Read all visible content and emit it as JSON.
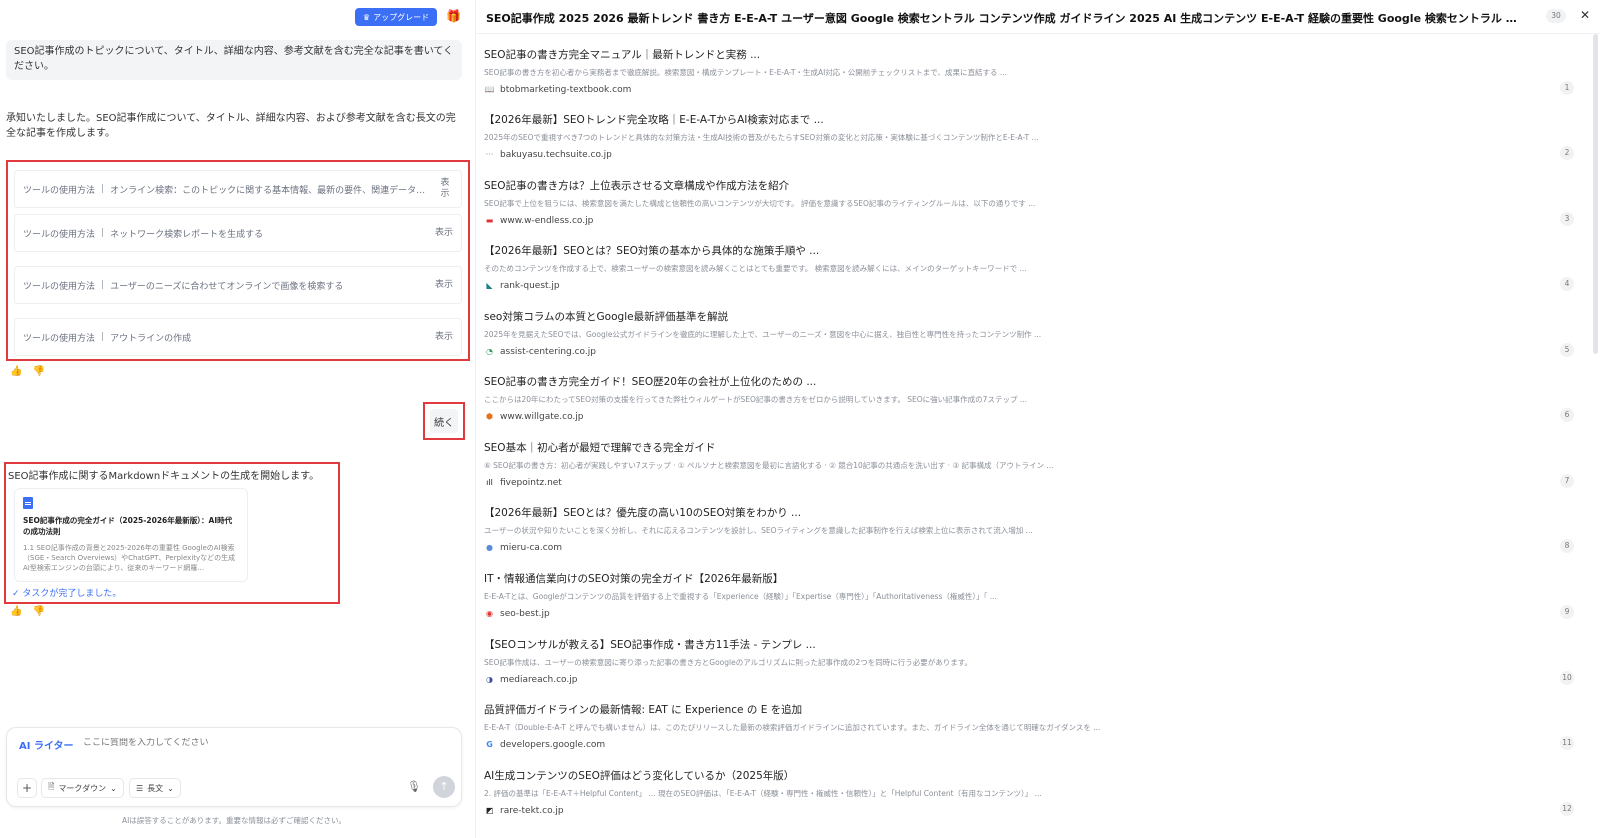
{
  "header": {
    "upgrade_label": "アップグレード"
  },
  "chat": {
    "user_message": "SEO記事作成のトピックについて、タイトル、詳細な内容、参考文献を含む完全な記事を書いてください。",
    "assistant_intro": "承知いたしました。SEO記事作成について、タイトル、詳細な内容、および参考文献を含む長文の完全な記事を作成します。",
    "tools": [
      {
        "label": "ツールの使用方法",
        "desc": "オンライン検索：このトピックに関する基本情報、最新の要件、関連データを...",
        "show": "表示"
      },
      {
        "label": "ツールの使用方法",
        "desc": "ネットワーク検索レポートを生成する",
        "show": "表示"
      },
      {
        "label": "ツールの使用方法",
        "desc": "ユーザーのニーズに合わせてオンラインで画像を検索する",
        "show": "表示"
      },
      {
        "label": "ツールの使用方法",
        "desc": "アウトラインの作成",
        "show": "表示"
      }
    ],
    "continue_label": "続く",
    "doc_intro": "SEO記事作成に関するMarkdownドキュメントの生成を開始します。",
    "doc_card": {
      "title": "SEO記事作成の完全ガイド（2025-2026年最新版）：AI時代の成功法則",
      "body": "1.1 SEO記事作成の背景と2025-2026年の重要性 GoogleのAI検索（SGE・Search Overviews）やChatGPT、Perplexityなどの生成AI型検索エンジンの台頭により、従来のキーワード網羅..."
    },
    "task_done": "タスクが完了しました。"
  },
  "composer": {
    "mode_label": "AI ライター",
    "placeholder": "ここに質問を入力してください",
    "format_label": "マークダウン",
    "length_label": "長文",
    "disclaimer": "AIは誤答することがあります。重要な情報は必ずご確認ください。"
  },
  "panel": {
    "title": "SEO記事作成 2025 2026 最新トレンド 書き方 E-E-A-T ユーザー意図 Google 検索セントラル コンテンツ作成 ガイドライン 2025 AI 生成コンテンツ E-E-A-T 経験の重要性 Google 検索セントラル コンテンツ作成 質の高い ...",
    "count": "30",
    "results": [
      {
        "title": "SEO記事の書き方完全マニュアル｜最新トレンドと実務 ...",
        "snippet": "SEO記事の書き方を初心者から実務者まで徹底解説。検索意図・構成テンプレート・E-E-A-T・生成AI対応・公開前チェックリストまで、成果に直結する ...",
        "domain": "btobmarketing-textbook.com",
        "num": "1",
        "fav": "📖",
        "favcolor": "#333"
      },
      {
        "title": "【2026年最新】SEOトレンド完全攻略｜E-E-A-TからAI検索対応まで ...",
        "snippet": "2025年のSEOで重視すべき7つのトレンドと具体的な対策方法・生成AI技術の普及がもたらすSEO対策の変化と対応策・実体験に基づくコンテンツ制作とE-E-A-T ...",
        "domain": "bakuyasu.techsuite.co.jp",
        "num": "2",
        "fav": "···",
        "favcolor": "#888"
      },
      {
        "title": "SEO記事の書き方は？上位表示させる文章構成や作成方法を紹介",
        "snippet": "SEO記事で上位を狙うには、検索意図を満たした構成と信頼性の高いコンテンツが大切です。 評価を意識するSEO記事のライティングルールは、以下の通りです ...",
        "domain": "www.w-endless.co.jp",
        "num": "3",
        "fav": "▬",
        "favcolor": "#d33"
      },
      {
        "title": "【2026年最新】SEOとは？SEO対策の基本から具体的な施策手順や ...",
        "snippet": "そのためコンテンツを作成する上で、検索ユーザーの検索意図を読み解くことはとても重要です。 検索意図を読み解くには、メインのターゲットキーワードで ...",
        "domain": "rank-quest.jp",
        "num": "4",
        "fav": "◣",
        "favcolor": "#1a7f86"
      },
      {
        "title": "seo対策コラムの本質とGoogle最新評価基準を解説",
        "snippet": "2025年を見据えたSEOでは、Google公式ガイドラインを徹底的に理解した上で、ユーザーのニーズ・意図を中心に据え、独自性と専門性を持ったコンテンツ制作 ...",
        "domain": "assist-centering.co.jp",
        "num": "5",
        "fav": "◔",
        "favcolor": "#2f9a5c"
      },
      {
        "title": "SEO記事の書き方完全ガイド！SEO歴20年の会社が上位化のための ...",
        "snippet": "ここからは20年にわたってSEO対策の支援を行ってきた弊社ウィルゲートがSEO記事の書き方をゼロから説明していきます。 SEOに強い記事作成の7ステップ ...",
        "domain": "www.willgate.co.jp",
        "num": "6",
        "fav": "⬢",
        "favcolor": "#e8701a"
      },
      {
        "title": "SEO基本｜初心者が最短で理解できる完全ガイド",
        "snippet": "⑥ SEO記事の書き方：初心者が実践しやすい7ステップ · ① ペルソナと検索意図を最初に言語化する · ② 競合10記事の共通点を洗い出す · ③ 記事構成（アウトライン ...",
        "domain": "fivepointz.net",
        "num": "7",
        "fav": "ıll",
        "favcolor": "#222"
      },
      {
        "title": "【2026年最新】SEOとは？優先度の高い10のSEO対策をわかり ...",
        "snippet": "ユーザーの状況や知りたいことを深く分析し、それに応えるコンテンツを設計し、SEOライティングを意識した記事制作を行えば検索上位に表示されて流入増加 ...",
        "domain": "mieru-ca.com",
        "num": "8",
        "fav": "●",
        "favcolor": "#5a8fd8"
      },
      {
        "title": "IT・情報通信業向けのSEO対策の完全ガイド【2026年最新版】",
        "snippet": "E-E-A-Tとは、Googleがコンテンツの品質を評価する上で重視する「Experience（経験）」「Expertise（専門性）」「Authoritativeness（権威性）」「 ...",
        "domain": "seo-best.jp",
        "num": "9",
        "fav": "◉",
        "favcolor": "#d33"
      },
      {
        "title": "【SEOコンサルが教える】SEO記事作成・書き方11手法 - テンプレ ...",
        "snippet": "SEO記事作成は、ユーザーの検索意図に寄り添った記事の書き方とGoogleのアルゴリズムに則った記事作成の2つを同時に行う必要があります。",
        "domain": "mediareach.co.jp",
        "num": "10",
        "fav": "◑",
        "favcolor": "#3b4fa0"
      },
      {
        "title": "品質評価ガイドラインの最新情報: EAT に Experience の E を追加",
        "snippet": "E-E-A-T（Double-E-A-T と呼んでも構いません）は、このたびリリースした最新の検索評価ガイドラインに追加されています。また、ガイドライン全体を通じて明確なガイダンスを ...",
        "domain": "developers.google.com",
        "num": "11",
        "fav": "G",
        "favcolor": "#4285f4"
      },
      {
        "title": "AI生成コンテンツのSEO評価はどう変化しているか（2025年版）",
        "snippet": "2. 評価の基準は「E-E-A-T＋Helpful Content」 ... 現在のSEO評価は、「E-E-A-T（経験・専門性・権威性・信頼性）」と「Helpful Content（有用なコンテンツ）」 ...",
        "domain": "rare-tekt.co.jp",
        "num": "12",
        "fav": "◩",
        "favcolor": "#222"
      }
    ]
  }
}
